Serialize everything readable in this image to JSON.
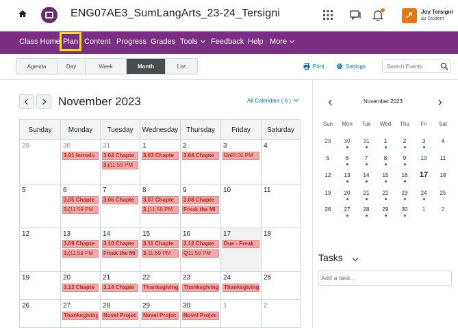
{
  "header": {
    "course_title": "ENG07AE3_SumLangArts_23-24_Tersigni",
    "user_name": "Joy Tersigni",
    "user_role": "as Student"
  },
  "nav": {
    "items": [
      "Class Home",
      "Plan",
      "Content",
      "Progress",
      "Grades",
      "Tools",
      "Feedback",
      "Help",
      "More"
    ],
    "highlighted": "Plan"
  },
  "toolbar": {
    "views": [
      "Agenda",
      "Day",
      "Week",
      "Month",
      "List"
    ],
    "active_view": "Month",
    "print_label": "Print",
    "settings_label": "Settings",
    "search_placeholder": "Search Events"
  },
  "calendar": {
    "month_title": "November 2023",
    "all_calendars_label": "All Calendars ( 6 )",
    "daynames": [
      "Sunday",
      "Monday",
      "Tuesday",
      "Wednesday",
      "Thursday",
      "Friday",
      "Saturday"
    ],
    "weeks": [
      [
        {
          "d": "29",
          "other": true,
          "events": []
        },
        {
          "d": "30",
          "other": true,
          "events": [
            {
              "text": "3.01 Introdu",
              "time": ""
            }
          ]
        },
        {
          "d": "31",
          "other": true,
          "events": [
            {
              "text": "3.02 Chapte",
              "time": ""
            },
            {
              "text": "3.(",
              "time": "11:59 PM"
            }
          ]
        },
        {
          "d": "1",
          "events": [
            {
              "text": "3.03 Chapte",
              "time": ""
            }
          ]
        },
        {
          "d": "2",
          "events": [
            {
              "text": "3.04 Chapte",
              "time": ""
            }
          ]
        },
        {
          "d": "3",
          "events": [
            {
              "text": "Uni",
              "time": "5:00 PM"
            }
          ]
        },
        {
          "d": "4",
          "events": []
        }
      ],
      [
        {
          "d": "5",
          "events": []
        },
        {
          "d": "6",
          "events": [
            {
              "text": "3.05 Chapte",
              "time": ""
            },
            {
              "text": "3.(",
              "time": "11:59 PM"
            }
          ]
        },
        {
          "d": "7",
          "events": [
            {
              "text": "3.06 Chapte",
              "time": ""
            }
          ]
        },
        {
          "d": "8",
          "events": [
            {
              "text": "3.07 Chapte",
              "time": ""
            },
            {
              "text": "3.(",
              "time": "11:59 PM"
            }
          ]
        },
        {
          "d": "9",
          "events": [
            {
              "text": "3.08 Chapte",
              "time": ""
            },
            {
              "text": "Freak the Mi",
              "time": ""
            }
          ]
        },
        {
          "d": "10",
          "events": []
        },
        {
          "d": "11",
          "events": []
        }
      ],
      [
        {
          "d": "12",
          "events": []
        },
        {
          "d": "13",
          "events": [
            {
              "text": "3.09 Chapte",
              "time": ""
            },
            {
              "text": "3.(",
              "time": "11:59 PM"
            }
          ]
        },
        {
          "d": "14",
          "events": [
            {
              "text": "3.10 Chapte",
              "time": ""
            },
            {
              "text": "Freak the Mi",
              "time": ""
            }
          ]
        },
        {
          "d": "15",
          "events": [
            {
              "text": "3.11 Chapte",
              "time": ""
            },
            {
              "text": "3.",
              "time": "11:59 PM"
            }
          ]
        },
        {
          "d": "16",
          "events": [
            {
              "text": "3.12 Chapte",
              "time": ""
            },
            {
              "text": "Q",
              "time": "11:59 PM"
            }
          ]
        },
        {
          "d": "17",
          "today": true,
          "events": [
            {
              "text": "Due - Freak",
              "time": ""
            }
          ]
        },
        {
          "d": "18",
          "events": []
        }
      ],
      [
        {
          "d": "19",
          "events": []
        },
        {
          "d": "20",
          "events": [
            {
              "text": "3.13 Chapte",
              "time": ""
            }
          ]
        },
        {
          "d": "21",
          "events": [
            {
              "text": "3.14 Chapte",
              "time": ""
            }
          ]
        },
        {
          "d": "22",
          "events": [
            {
              "text": "Thanksgiving",
              "time": ""
            }
          ]
        },
        {
          "d": "23",
          "events": [
            {
              "text": "Thanksgiving",
              "time": ""
            }
          ]
        },
        {
          "d": "24",
          "events": [
            {
              "text": "Thanksgiving",
              "time": ""
            }
          ]
        },
        {
          "d": "25",
          "events": []
        }
      ],
      [
        {
          "d": "26",
          "events": []
        },
        {
          "d": "27",
          "events": [
            {
              "text": "Thanksgiving",
              "time": ""
            }
          ]
        },
        {
          "d": "28",
          "events": [
            {
              "text": "Novel Projec",
              "time": ""
            }
          ]
        },
        {
          "d": "29",
          "events": [
            {
              "text": "Novel Projec",
              "time": ""
            }
          ]
        },
        {
          "d": "30",
          "events": [
            {
              "text": "Novel Projec",
              "time": ""
            }
          ]
        },
        {
          "d": "1",
          "other": true,
          "events": []
        },
        {
          "d": "2",
          "other": true,
          "events": []
        }
      ]
    ]
  },
  "mini_calendar": {
    "title": "November 2023",
    "dow": [
      "Sun",
      "Mon",
      "Tue",
      "Wed",
      "Thu",
      "Fri",
      "Sat"
    ],
    "weeks": [
      [
        {
          "d": "29",
          "o": true
        },
        {
          "d": "30",
          "o": true,
          "dot": true
        },
        {
          "d": "31",
          "o": true,
          "dot": true
        },
        {
          "d": "1",
          "dot": true
        },
        {
          "d": "2",
          "dot": true
        },
        {
          "d": "3",
          "dot": true
        },
        {
          "d": "4"
        }
      ],
      [
        {
          "d": "5"
        },
        {
          "d": "6",
          "dot": true
        },
        {
          "d": "7",
          "dot": true
        },
        {
          "d": "8",
          "dot": true
        },
        {
          "d": "9",
          "dot": true
        },
        {
          "d": "10"
        },
        {
          "d": "11"
        }
      ],
      [
        {
          "d": "12"
        },
        {
          "d": "13",
          "dot": true
        },
        {
          "d": "14",
          "dot": true
        },
        {
          "d": "15",
          "dot": true
        },
        {
          "d": "16",
          "dot": true
        },
        {
          "d": "17",
          "t": true
        },
        {
          "d": "18"
        }
      ],
      [
        {
          "d": "19"
        },
        {
          "d": "20",
          "dot": true
        },
        {
          "d": "21",
          "dot": true
        },
        {
          "d": "22",
          "dot": true
        },
        {
          "d": "23",
          "dot": true
        },
        {
          "d": "24",
          "dot": true
        },
        {
          "d": "25"
        }
      ],
      [
        {
          "d": "26"
        },
        {
          "d": "27",
          "dot": true
        },
        {
          "d": "28",
          "dot": true
        },
        {
          "d": "29",
          "dot": true
        },
        {
          "d": "30",
          "dot": true
        },
        {
          "d": "1",
          "o": true
        },
        {
          "d": "2",
          "o": true
        }
      ]
    ]
  },
  "tasks": {
    "title": "Tasks",
    "placeholder": "Add a task..."
  },
  "colors": {
    "nav_bg": "#7b2f84",
    "highlight": "#f7e500",
    "event_bg": "#f2a8a8",
    "event_text": "#b3261e",
    "link": "#006fbf",
    "accent": "#e87511"
  }
}
